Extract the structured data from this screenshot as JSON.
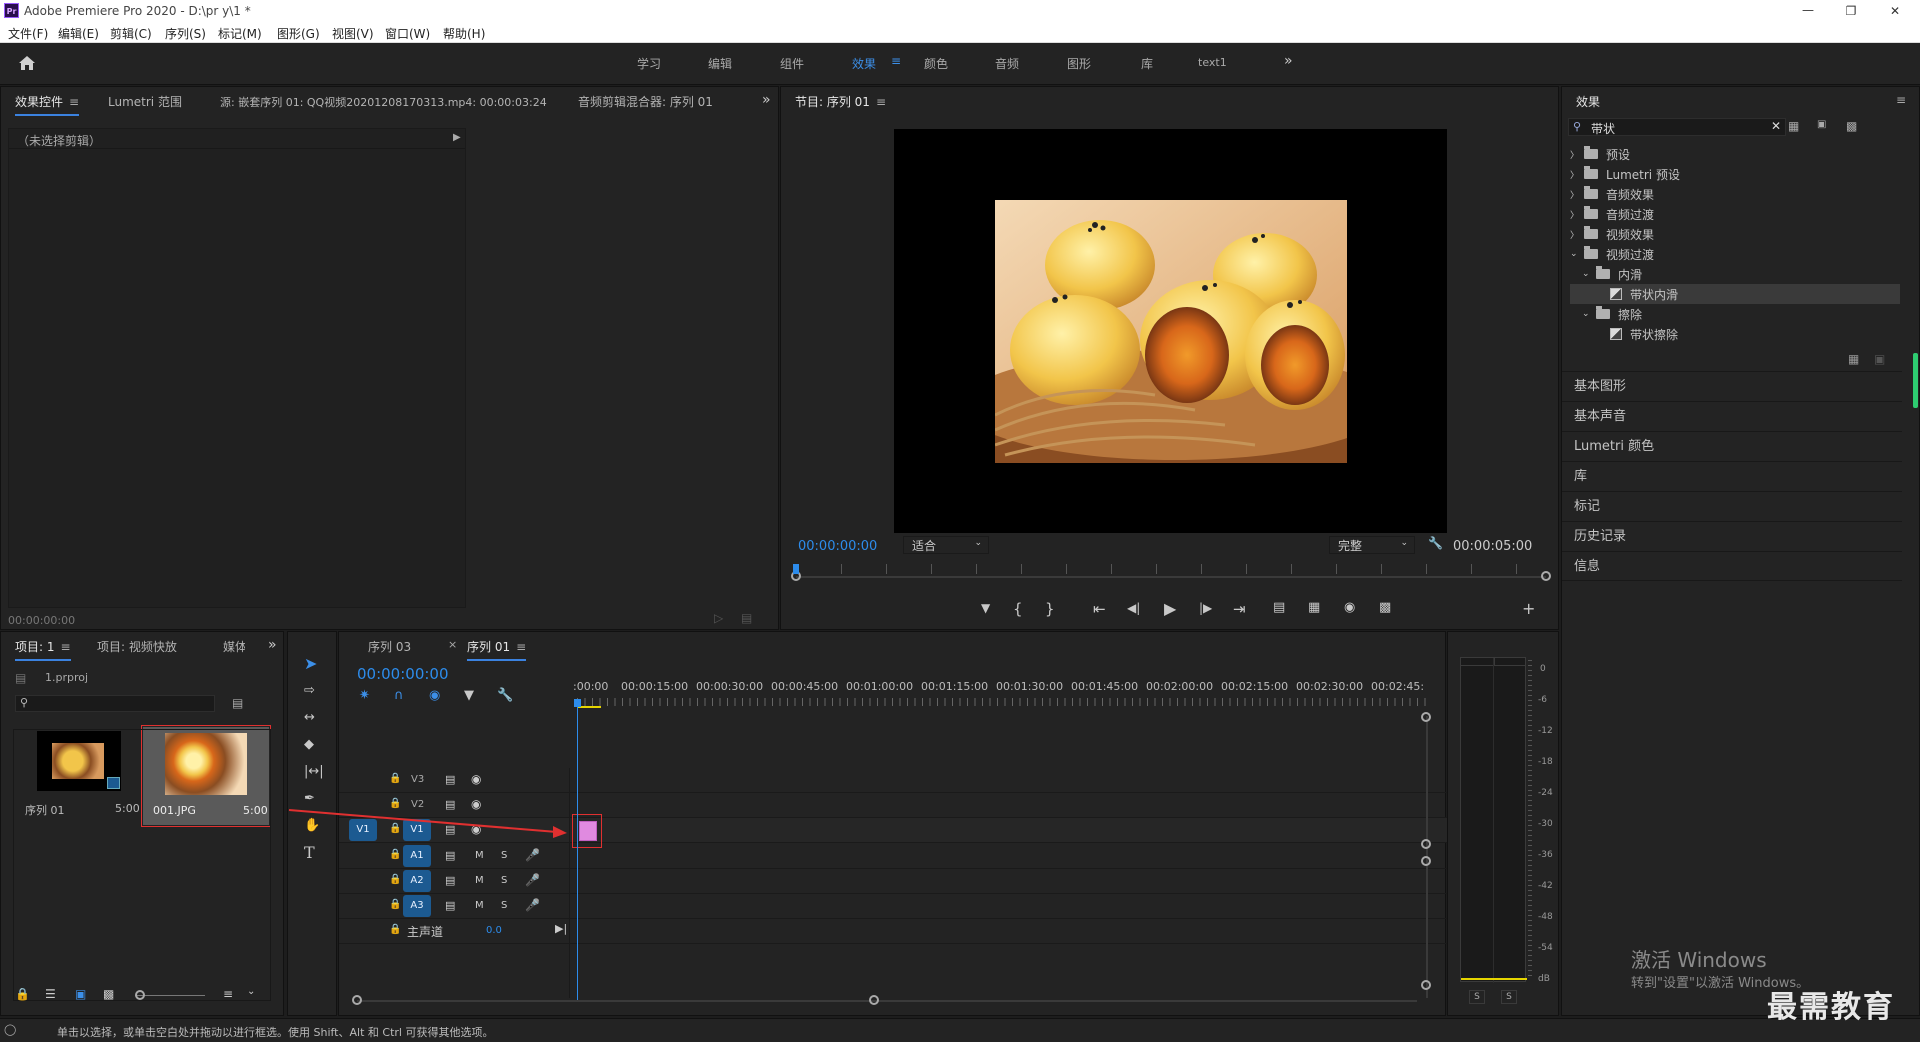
{
  "app": {
    "title": "Adobe Premiere Pro 2020 - D:\\pr y\\1 *",
    "logo": "Pr"
  },
  "menu": [
    "文件(F)",
    "编辑(E)",
    "剪辑(C)",
    "序列(S)",
    "标记(M)",
    "图形(G)",
    "视图(V)",
    "窗口(W)",
    "帮助(H)"
  ],
  "workspaces": {
    "items": [
      "学习",
      "编辑",
      "组件",
      "效果",
      "颜色",
      "音频",
      "图形",
      "库",
      "text1"
    ],
    "active": "效果"
  },
  "source_panel": {
    "tabs": [
      "效果控件",
      "Lumetri 范围",
      "源: 嵌套序列 01: QQ视频20201208170313.mp4: 00:00:03:24",
      "音频剪辑混合器: 序列 01"
    ],
    "no_clip": "（未选择剪辑）",
    "timecode": "00:00:00:00"
  },
  "program_monitor": {
    "title": "节目: 序列 01",
    "timecode_left": "00:00:00:00",
    "fit": "适合",
    "quality": "完整",
    "timecode_right": "00:00:05:00"
  },
  "effects_panel": {
    "title": "效果",
    "search_value": "带状",
    "tree": [
      {
        "label": "预设",
        "level": 0,
        "type": "folder"
      },
      {
        "label": "Lumetri 预设",
        "level": 0,
        "type": "folder"
      },
      {
        "label": "音频效果",
        "level": 0,
        "type": "folder"
      },
      {
        "label": "音频过渡",
        "level": 0,
        "type": "folder"
      },
      {
        "label": "视频效果",
        "level": 0,
        "type": "folder"
      },
      {
        "label": "视频过渡",
        "level": 0,
        "type": "folder-open"
      },
      {
        "label": "内滑",
        "level": 1,
        "type": "folder-open"
      },
      {
        "label": "带状内滑",
        "level": 2,
        "type": "effect",
        "selected": true
      },
      {
        "label": "擦除",
        "level": 1,
        "type": "folder-open"
      },
      {
        "label": "带状擦除",
        "level": 2,
        "type": "effect"
      }
    ],
    "sections": [
      "基本图形",
      "基本声音",
      "Lumetri 颜色",
      "库",
      "标记",
      "历史记录",
      "信息"
    ]
  },
  "project_panel": {
    "tabs": [
      "项目: 1",
      "项目: 视频快放",
      "媒体"
    ],
    "project_file": "1.prproj",
    "items": [
      {
        "name": "序列 01",
        "duration": "5:00"
      },
      {
        "name": "001.JPG",
        "duration": "5:00"
      }
    ]
  },
  "timeline": {
    "tabs": [
      "序列 03",
      "序列 01"
    ],
    "timecode": "00:00:00:00",
    "ruler": [
      ":00:00",
      "00:00:15:00",
      "00:00:30:00",
      "00:00:45:00",
      "00:01:00:00",
      "00:01:15:00",
      "00:01:30:00",
      "00:01:45:00",
      "00:02:00:00",
      "00:02:15:00",
      "00:02:30:00",
      "00:02:45:"
    ],
    "video_tracks": [
      "V3",
      "V2",
      "V1"
    ],
    "audio_tracks": [
      "A1",
      "A2",
      "A3"
    ],
    "source_patch": "V1",
    "master_label": "主声道",
    "master_value": "0.0",
    "mute": "M",
    "solo": "S"
  },
  "audio_meter": {
    "scale": [
      "0",
      "-6",
      "-12",
      "-18",
      "-24",
      "-30",
      "-36",
      "-42",
      "-48",
      "-54",
      "dB"
    ],
    "solo_buttons": [
      "S",
      "S"
    ]
  },
  "status_bar": {
    "text": "单击以选择，或单击空白处并拖动以进行框选。使用 Shift、Alt 和 Ctrl 可获得其他选项。"
  },
  "watermark": {
    "activate_title": "激活 Windows",
    "activate_sub": "转到\"设置\"以激活 Windows。",
    "brand": "最需教育"
  },
  "colors": {
    "accent": "#2d8ceb",
    "clip": "#e08ae0",
    "annotation": "#e03030"
  }
}
